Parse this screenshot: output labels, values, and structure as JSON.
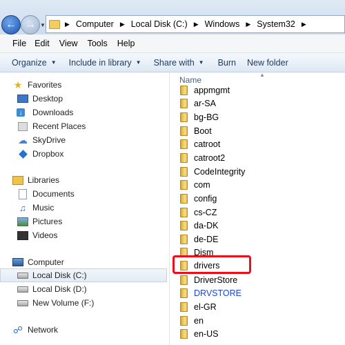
{
  "address_bar": {
    "breadcrumbs": [
      "Computer",
      "Local Disk (C:)",
      "Windows",
      "System32"
    ]
  },
  "menu": {
    "items": [
      "File",
      "Edit",
      "View",
      "Tools",
      "Help"
    ]
  },
  "toolbar": {
    "organize": "Organize",
    "include_in_library": "Include in library",
    "share_with": "Share with",
    "burn": "Burn",
    "new_folder": "New folder"
  },
  "nav": {
    "favorites_header": "Favorites",
    "favorites": [
      "Desktop",
      "Downloads",
      "Recent Places",
      "SkyDrive",
      "Dropbox"
    ],
    "libraries_header": "Libraries",
    "libraries": [
      "Documents",
      "Music",
      "Pictures",
      "Videos"
    ],
    "computer_header": "Computer",
    "drives": [
      "Local Disk (C:)",
      "Local Disk (D:)",
      "New Volume (F:)"
    ],
    "network_header": "Network"
  },
  "content": {
    "column_header": "Name",
    "files": [
      "appmgmt",
      "ar-SA",
      "bg-BG",
      "Boot",
      "catroot",
      "catroot2",
      "CodeIntegrity",
      "com",
      "config",
      "cs-CZ",
      "da-DK",
      "de-DE",
      "Dism",
      "drivers",
      "DriverStore",
      "DRVSTORE",
      "el-GR",
      "en",
      "en-US"
    ],
    "highlighted": "drivers",
    "blue_item": "DRVSTORE"
  },
  "colors": {
    "highlight_border": "#e8101a",
    "blue_text": "#1b45d6",
    "toolbar_text": "#1e395b"
  }
}
